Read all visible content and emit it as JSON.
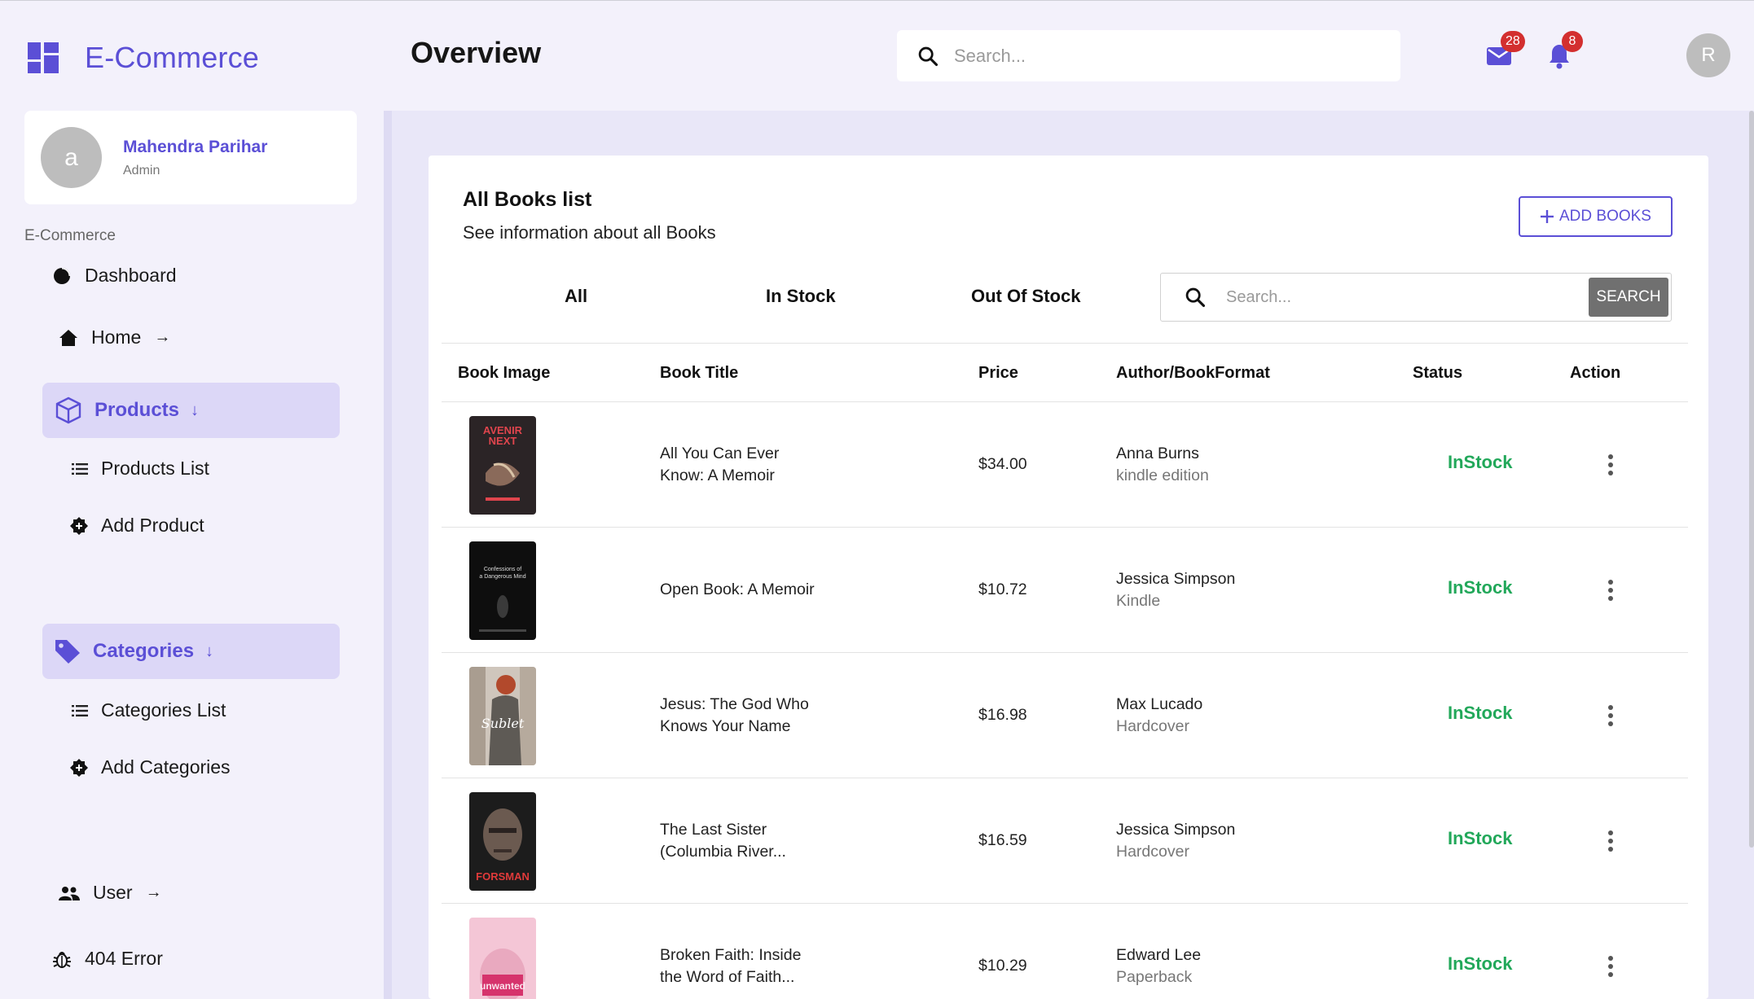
{
  "app": {
    "brand": "E-Commerce",
    "page_title": "Overview",
    "search_placeholder": "Search...",
    "mail_count": "28",
    "notification_count": "8",
    "user_initial": "R"
  },
  "colors": {
    "accent": "#5b4fd6",
    "active_bg": "#dcd7f7",
    "status_green": "#22a85a",
    "badge_red": "#d32f2f"
  },
  "sidebar": {
    "profile": {
      "initial": "a",
      "name": "Mahendra Parihar",
      "role": "Admin"
    },
    "section_label": "E-Commerce",
    "items": [
      {
        "label": "Dashboard",
        "icon": "pie-chart-icon"
      },
      {
        "label": "Home",
        "icon": "home-icon"
      },
      {
        "label": "Products",
        "icon": "box-icon",
        "active": true
      },
      {
        "label": "Products List",
        "icon": "list-icon"
      },
      {
        "label": "Add Product",
        "icon": "add-badge-icon"
      },
      {
        "label": "Categories",
        "icon": "tag-icon",
        "active": true
      },
      {
        "label": "Categories List",
        "icon": "list-icon"
      },
      {
        "label": "Add Categories",
        "icon": "add-badge-icon"
      },
      {
        "label": "User",
        "icon": "users-icon"
      },
      {
        "label": "404 Error",
        "icon": "bug-icon"
      }
    ]
  },
  "books_card": {
    "title": "All Books list",
    "subtitle": "See information about all Books",
    "add_button": "ADD BOOKS",
    "tabs": [
      "All",
      "In Stock",
      "Out Of Stock"
    ],
    "search_placeholder": "Search...",
    "search_button": "SEARCH",
    "columns": [
      "Book Image",
      "Book Title",
      "Price",
      "Author/BookFormat",
      "Status",
      "Action"
    ],
    "rows": [
      {
        "title_line1": "All You Can Ever",
        "title_line2": "Know: A Memoir",
        "price": "$34.00",
        "author": "Anna Burns",
        "format": "kindle edition",
        "status": "InStock",
        "cover": "avenir-next-cover"
      },
      {
        "title_line1": "Open Book: A Memoir",
        "title_line2": "",
        "price": "$10.72",
        "author": "Jessica Simpson",
        "format": "Kindle",
        "status": "InStock",
        "cover": "confessions-cover"
      },
      {
        "title_line1": "Jesus: The God Who",
        "title_line2": "Knows Your Name",
        "price": "$16.98",
        "author": "Max Lucado",
        "format": "Hardcover",
        "status": "InStock",
        "cover": "sublet-cover"
      },
      {
        "title_line1": "The Last Sister",
        "title_line2": "(Columbia River...",
        "price": "$16.59",
        "author": "Jessica Simpson",
        "format": "Hardcover",
        "status": "InStock",
        "cover": "forsman-cover"
      },
      {
        "title_line1": "Broken Faith: Inside",
        "title_line2": "the Word of Faith...",
        "price": "$10.29",
        "author": "Edward Lee",
        "format": "Paperback",
        "status": "InStock",
        "cover": "pink-cover"
      }
    ]
  }
}
